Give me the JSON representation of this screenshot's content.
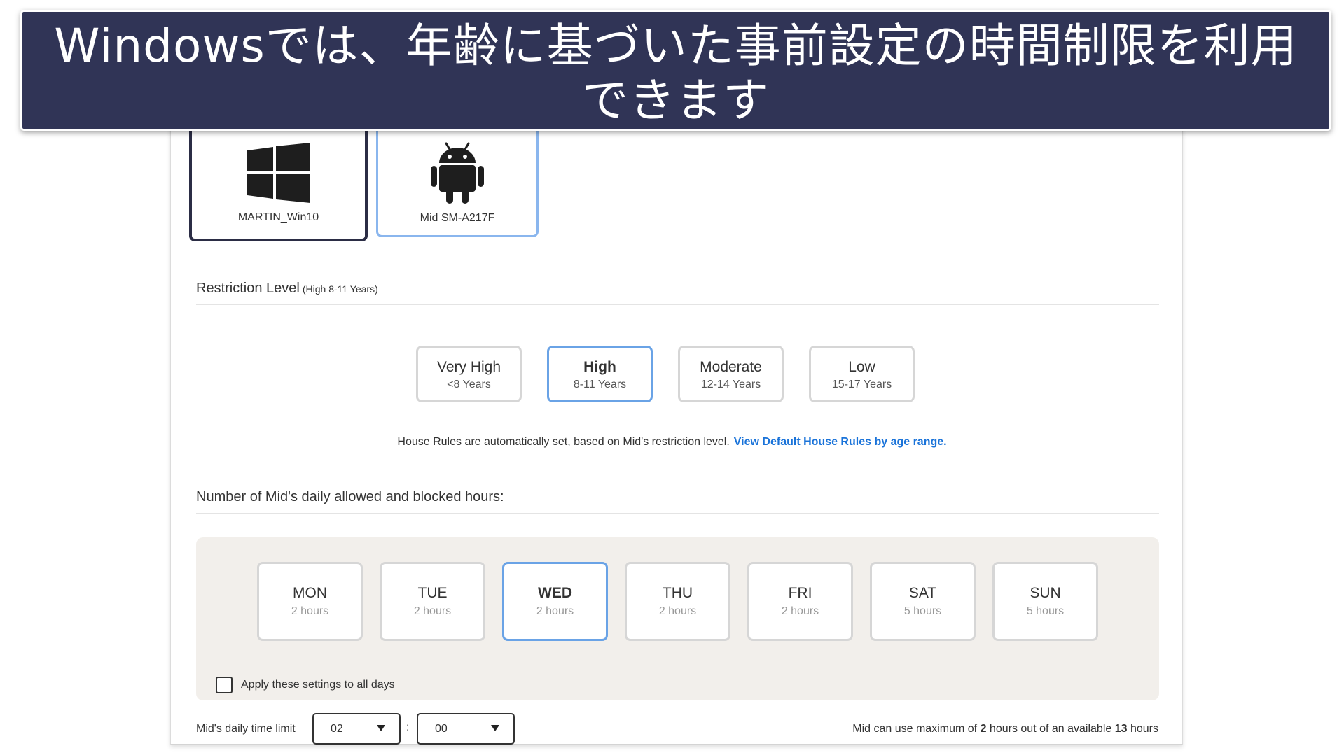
{
  "banner": {
    "line1": "Windowsでは、年齢に基づいた事前設定の時間制限を利用",
    "line2": "できます"
  },
  "devices": [
    {
      "name": "MARTIN_Win10",
      "icon": "windows-logo-icon",
      "selected": true
    },
    {
      "name": "Mid SM-A217F",
      "icon": "android-robot-icon",
      "selected": false
    }
  ],
  "restriction": {
    "title": "Restriction Level",
    "subtitle": "(High 8-11 Years)",
    "levels": [
      {
        "name": "Very High",
        "age": "<8 Years"
      },
      {
        "name": "High",
        "age": "8-11 Years",
        "selected": true
      },
      {
        "name": "Moderate",
        "age": "12-14 Years"
      },
      {
        "name": "Low",
        "age": "15-17 Years"
      }
    ],
    "info_text": "House Rules are automatically set, based on Mid's restriction level.",
    "info_link": "View Default House Rules by age range."
  },
  "hours": {
    "title": "Number of Mid's daily allowed and blocked hours:",
    "days": [
      {
        "name": "MON",
        "hours": "2 hours"
      },
      {
        "name": "TUE",
        "hours": "2 hours"
      },
      {
        "name": "WED",
        "hours": "2 hours",
        "selected": true
      },
      {
        "name": "THU",
        "hours": "2 hours"
      },
      {
        "name": "FRI",
        "hours": "2 hours"
      },
      {
        "name": "SAT",
        "hours": "5 hours"
      },
      {
        "name": "SUN",
        "hours": "5 hours"
      }
    ],
    "apply_all_label": "Apply these settings to all days",
    "apply_all_checked": false
  },
  "time_limit": {
    "label": "Mid's daily time limit",
    "hours_value": "02",
    "minutes_value": "00",
    "separator": ":",
    "summary_prefix": "Mid can use maximum of",
    "summary_used": "2",
    "summary_middle": "hours out of an available",
    "summary_total": "13",
    "summary_suffix": "hours"
  },
  "colors": {
    "banner_bg": "#303456",
    "selected_border": "#6aa3e6",
    "device_selected_border": "#2b2d45",
    "link": "#1a73d9",
    "panel_bg": "#f2efeb"
  }
}
